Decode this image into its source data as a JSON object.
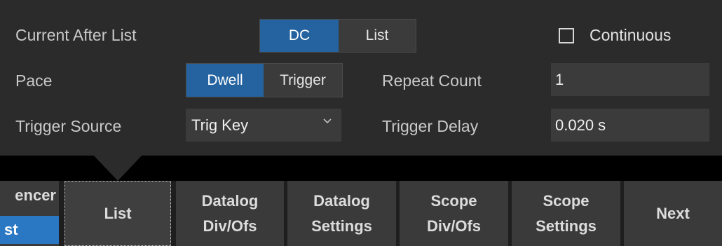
{
  "settings": {
    "current_after_list": {
      "label": "Current After List",
      "options": [
        "DC",
        "List"
      ],
      "selected": "DC"
    },
    "continuous": {
      "label": "Continuous",
      "checked": false
    },
    "pace": {
      "label": "Pace",
      "options": [
        "Dwell",
        "Trigger"
      ],
      "selected": "Dwell"
    },
    "repeat_count": {
      "label": "Repeat Count",
      "value": "1"
    },
    "trigger_source": {
      "label": "Trigger Source",
      "value": "Trig Key"
    },
    "trigger_delay": {
      "label": "Trigger Delay",
      "value": "0.020 s"
    }
  },
  "softkeys": {
    "partial": {
      "line1": "encer",
      "line2": "st"
    },
    "list": {
      "label": "List"
    },
    "datalog_divofs": {
      "line1": "Datalog",
      "line2": "Div/Ofs"
    },
    "datalog_settings": {
      "line1": "Datalog",
      "line2": "Settings"
    },
    "scope_divofs": {
      "line1": "Scope",
      "line2": "Div/Ofs"
    },
    "scope_settings": {
      "line1": "Scope",
      "line2": "Settings"
    },
    "next": {
      "label": "Next"
    }
  },
  "colors": {
    "accent": "#2463a0",
    "panel": "#2b2b2b",
    "softkey": "#3a3a3a"
  }
}
